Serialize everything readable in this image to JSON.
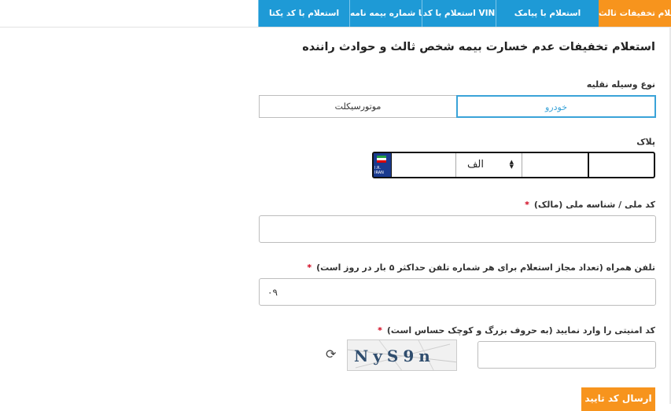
{
  "tabs": [
    {
      "label": "استعلام تخفیفات ثالث",
      "active": true
    },
    {
      "label": "استعلام با پیامک"
    },
    {
      "label": "استعلام با کد VIN"
    },
    {
      "label": "استعلام با شماره بیمه نامه"
    },
    {
      "label": "استعلام با کد یکتا"
    }
  ],
  "page": {
    "title": "استعلام تخفیفات عدم خسارت بیمه شخص ثالث و حوادث راننده"
  },
  "vehicle": {
    "label": "نوع وسیله نقلیه",
    "options": [
      {
        "label": "خودرو",
        "selected": true
      },
      {
        "label": "موتورسیکلت",
        "selected": false
      }
    ]
  },
  "plate": {
    "label": "پلاک",
    "letter": "الف",
    "country_text": "I.R. IRAN"
  },
  "national_id": {
    "label": "کد ملی / شناسه ملی (مالک)",
    "required_mark": "*",
    "value": ""
  },
  "mobile": {
    "label": "تلفن همراه (تعداد مجاز استعلام برای هر شماره تلفن حداکثر ۵ بار در روز است)",
    "required_mark": "*",
    "prefix": "۰۹"
  },
  "captcha": {
    "label": "کد امنیتی را وارد نمایید (به حروف بزرگ و کوچک حساس است)",
    "required_mark": "*",
    "image_text": "NyS9n",
    "value": ""
  },
  "actions": {
    "submit_label": "ارسال کد تایید"
  },
  "icons": {
    "refresh": "refresh-icon",
    "select_arrows": "select-arrows-icon",
    "flag": "iran-flag-icon"
  },
  "colors": {
    "tab_blue": "#1e9ad6",
    "tab_orange": "#f7941d",
    "accent": "#3aa3d8",
    "required": "#d0021b"
  }
}
